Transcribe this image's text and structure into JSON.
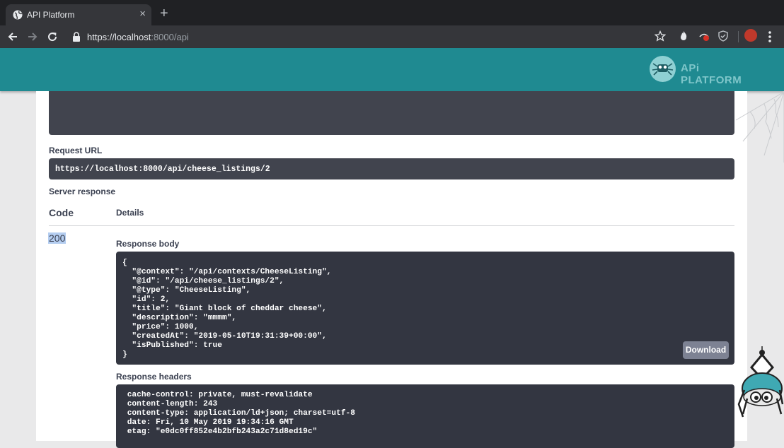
{
  "browser": {
    "tab_title": "API Platform",
    "tab_close": "×",
    "new_tab": "+",
    "url_host": "https://localhost",
    "url_path": ":8000/api"
  },
  "header": {
    "logo_text": "APi PLATFORM"
  },
  "request_url": {
    "label": "Request URL",
    "value": "https://localhost:8000/api/cheese_listings/2"
  },
  "server_response": {
    "label": "Server response",
    "col_code": "Code",
    "col_details": "Details",
    "status_code": "200",
    "response_body_label": "Response body",
    "response_body": "{\n  \"@context\": \"/api/contexts/CheeseListing\",\n  \"@id\": \"/api/cheese_listings/2\",\n  \"@type\": \"CheeseListing\",\n  \"id\": 2,\n  \"title\": \"Giant block of cheddar cheese\",\n  \"description\": \"mmmm\",\n  \"price\": 1000,\n  \"createdAt\": \"2019-05-10T19:31:39+00:00\",\n  \"isPublished\": true\n}",
    "download_label": "Download",
    "response_headers_label": "Response headers",
    "response_headers": " cache-control: private, must-revalidate\n content-length: 243\n content-type: application/ld+json; charset=utf-8\n date: Fri, 10 May 2019 19:34:16 GMT\n etag: \"e0dc0ff852e4b2bfb243a2c71d8ed19c\""
  },
  "colors": {
    "header_teal": "#1f8a91",
    "code_bg": "#333641",
    "selection": "#b4cdf0"
  }
}
